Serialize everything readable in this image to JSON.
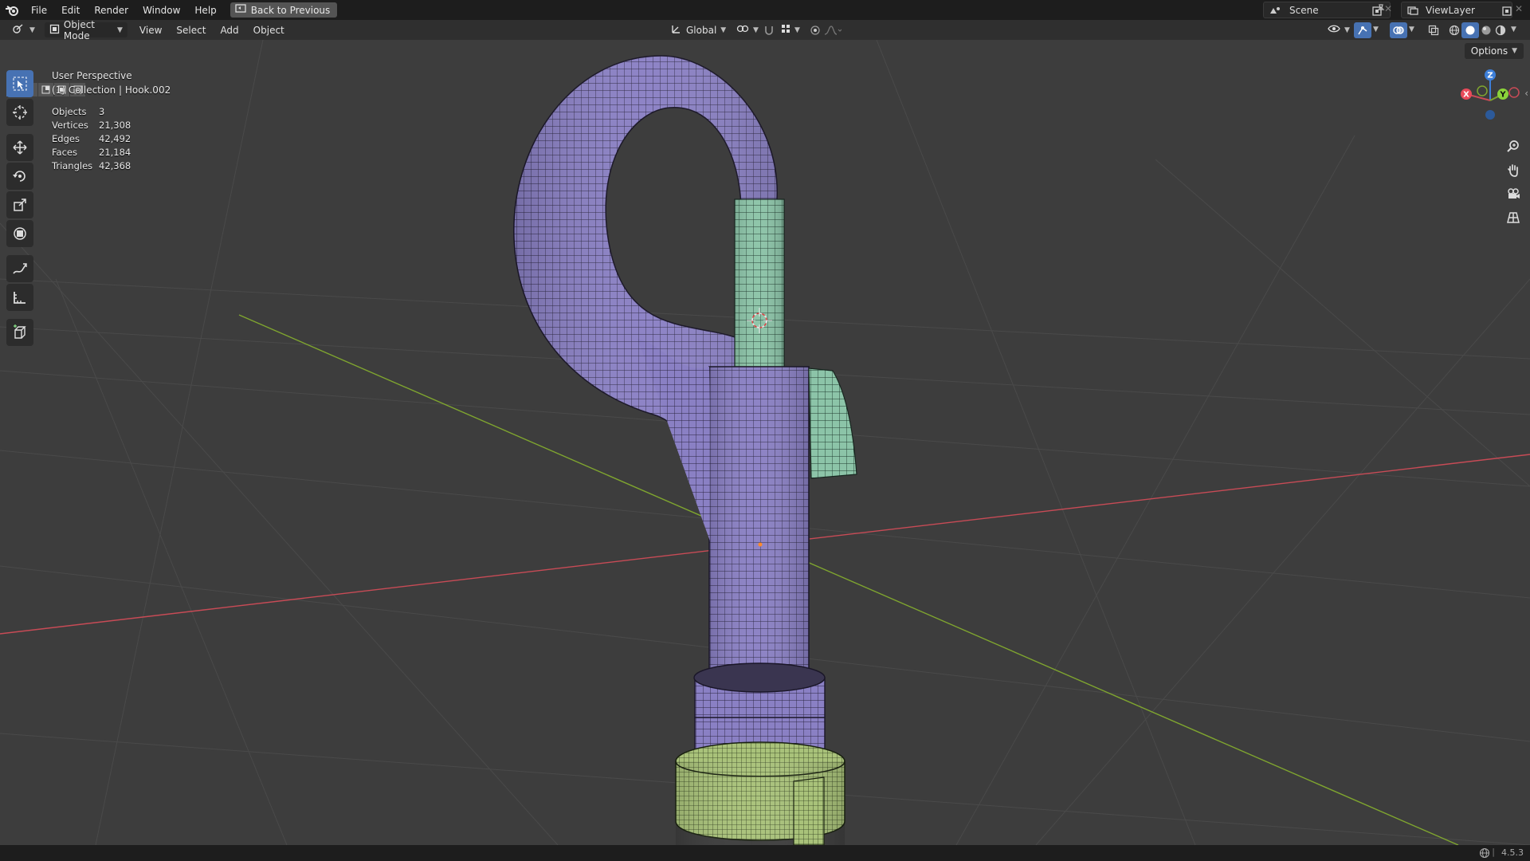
{
  "menu": {
    "file": "File",
    "edit": "Edit",
    "render": "Render",
    "window": "Window",
    "help": "Help",
    "back_to_previous": "Back to Previous"
  },
  "workspace": {
    "scene_name": "Scene",
    "view_layer": "ViewLayer"
  },
  "header": {
    "mode": "Object Mode",
    "view": "View",
    "select": "Select",
    "add": "Add",
    "object": "Object",
    "transform_orientation": "Global",
    "options": "Options"
  },
  "viewport": {
    "perspective": "User Perspective",
    "collection": "(1) Collection | Hook.002",
    "stats": [
      {
        "label": "Objects",
        "value": "3"
      },
      {
        "label": "Vertices",
        "value": "21,308"
      },
      {
        "label": "Edges",
        "value": "42,492"
      },
      {
        "label": "Faces",
        "value": "21,184"
      },
      {
        "label": "Triangles",
        "value": "42,368"
      }
    ],
    "gizmo": {
      "x": "X",
      "y": "Y",
      "z": "Z"
    }
  },
  "status": {
    "version": "4.5.3"
  },
  "colors": {
    "hook_body": "#8a80c4",
    "hook_green": "#8cc4a8",
    "nut_green": "#a9c27a",
    "x_axis": "#c84b56",
    "y_axis": "#7fa52f",
    "active_tool": "#4772b3"
  },
  "tools": [
    "select-box-icon",
    "cursor-icon",
    "move-icon",
    "rotate-icon",
    "scale-icon",
    "transform-icon",
    "annotate-icon",
    "measure-icon",
    "add-cube-icon"
  ]
}
